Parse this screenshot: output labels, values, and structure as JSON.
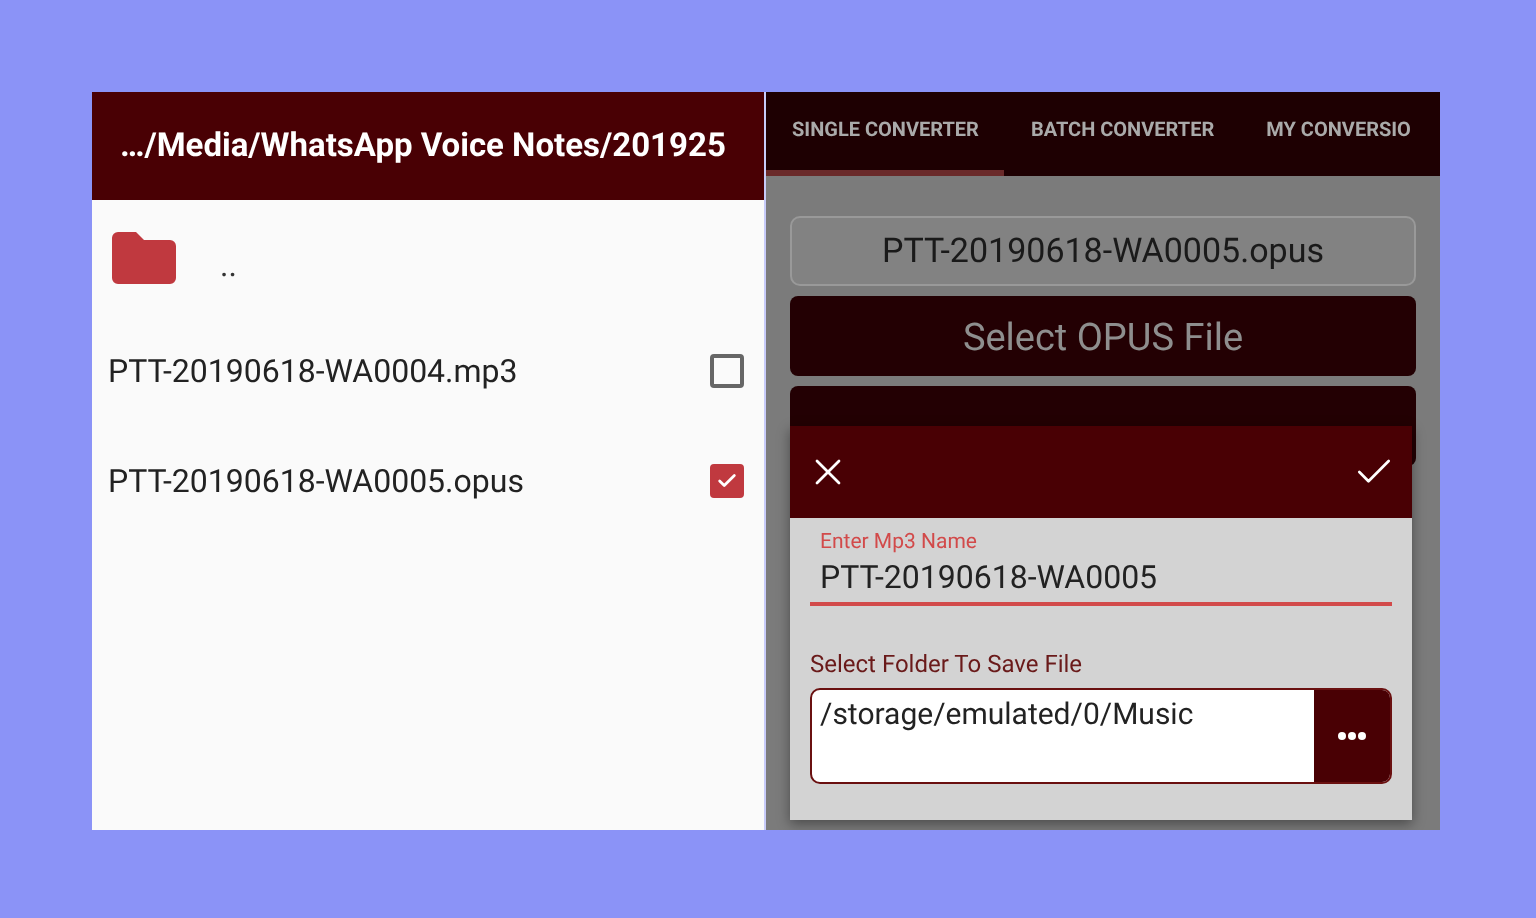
{
  "file_browser": {
    "path": "…/Media/WhatsApp Voice Notes/201925",
    "items": [
      {
        "kind": "folder",
        "name": ".."
      },
      {
        "kind": "file",
        "name": "PTT-20190618-WA0004.mp3",
        "checked": false
      },
      {
        "kind": "file",
        "name": "PTT-20190618-WA0005.opus",
        "checked": true
      }
    ]
  },
  "converter": {
    "tabs": [
      {
        "label": "SINGLE CONVERTER",
        "selected": true
      },
      {
        "label": "BATCH CONVERTER",
        "selected": false
      },
      {
        "label": "MY CONVERSIO",
        "selected": false
      }
    ],
    "selected_file": "PTT-20190618-WA0005.opus",
    "buttons": [
      "Select OPUS File"
    ],
    "dialog": {
      "name_label": "Enter Mp3 Name",
      "name_value": "PTT-20190618-WA0005",
      "folder_label": "Select Folder To Save File",
      "folder_value": "/storage/emulated/0/Music"
    }
  }
}
